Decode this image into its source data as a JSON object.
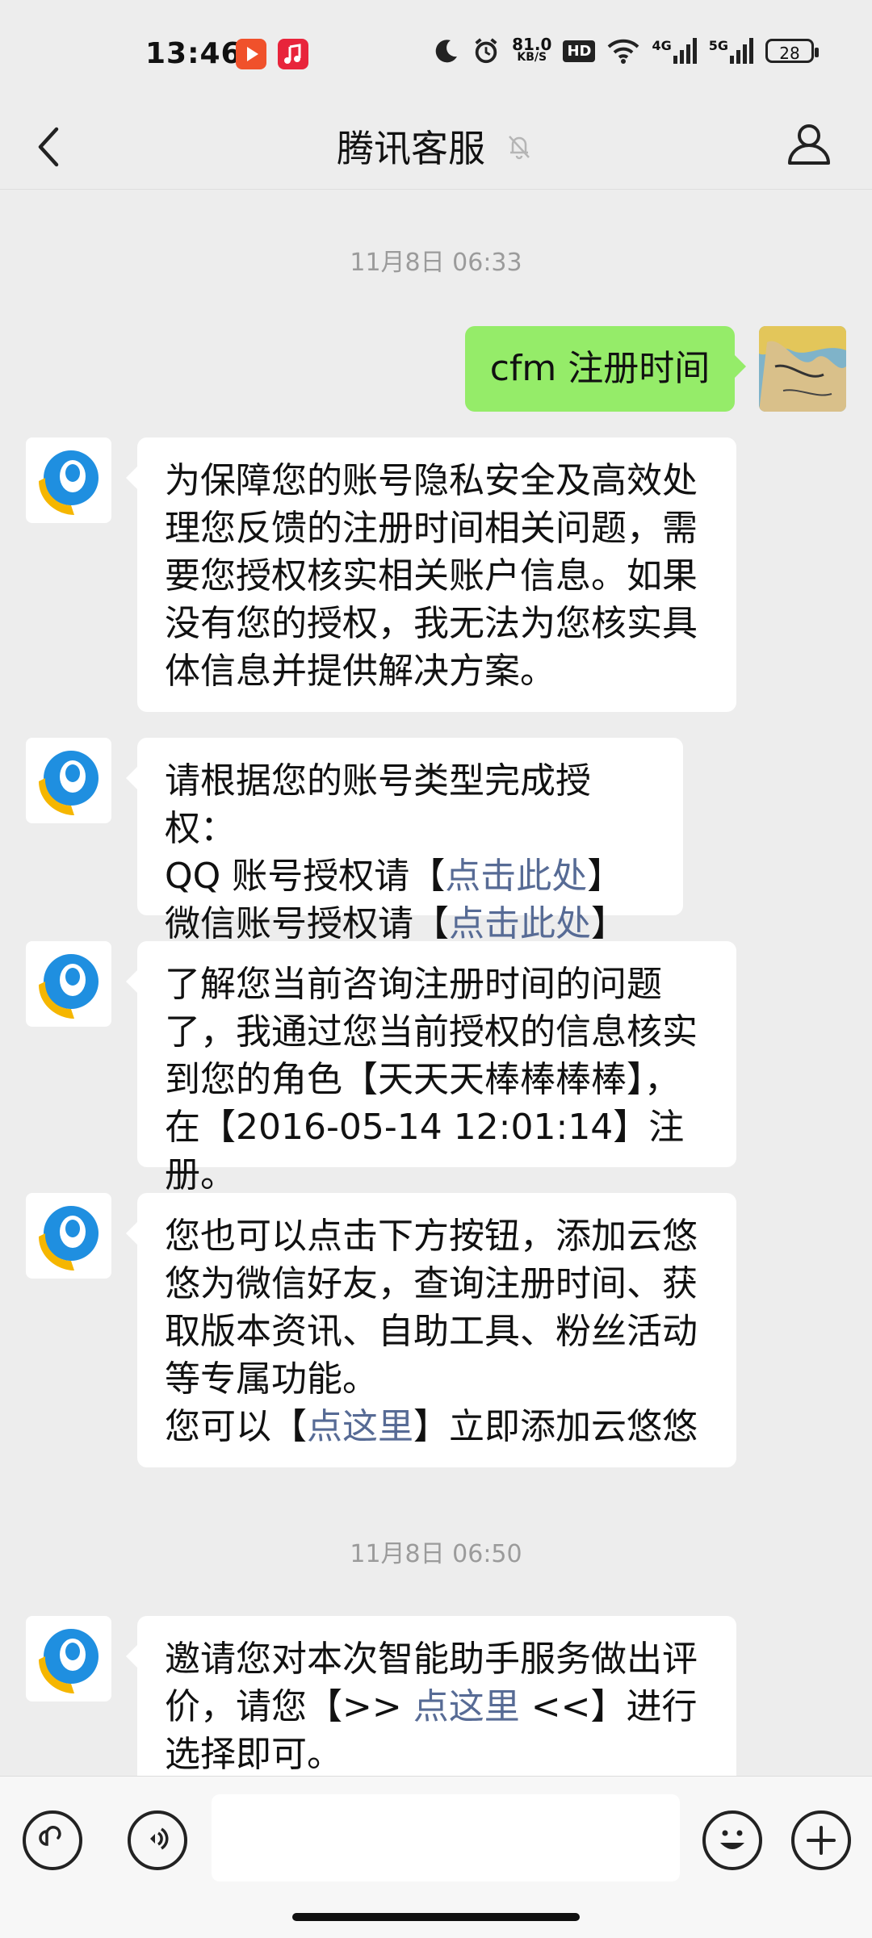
{
  "status_bar": {
    "time": "13:46",
    "net_speed_value": "81.0",
    "net_speed_unit": "KB/S",
    "hd_label": "HD",
    "net_4g": "4G",
    "net_5g": "5G",
    "battery": "28"
  },
  "header": {
    "title": "腾讯客服",
    "icons": [
      "back-icon",
      "mute-bell-icon",
      "profile-icon"
    ]
  },
  "chat": {
    "timestamp_1": "11月8日 06:33",
    "my_message": "cfm 注册时间",
    "msg1": "为保障您的账号隐私安全及高效处理您反馈的注册时间相关问题，需要您授权核实相关账户信息。如果没有您的授权，我无法为您核实具体信息并提供解决方案。",
    "msg2": {
      "line1": "请根据您的账号类型完成授权：",
      "line2_prefix": "QQ 账号授权请【",
      "line2_link": "点击此处",
      "line2_suffix": "】",
      "line3_prefix": "微信账号授权请【",
      "line3_link": "点击此处",
      "line3_suffix": "】"
    },
    "msg3": "了解您当前咨询注册时间的问题了，我通过您当前授权的信息核实到您的角色【天天天棒棒棒棒】，在【2016-05-14 12:01:14】注册。",
    "msg4": {
      "body": "您也可以点击下方按钮，添加云悠悠为微信好友，查询注册时间、获取版本资讯、自助工具、粉丝活动等专属功能。",
      "prefix": "您可以【",
      "link": "点这里",
      "suffix": "】立即添加云悠悠"
    },
    "timestamp_2": "11月8日 06:50",
    "msg5": {
      "prefix": "邀请您对本次智能助手服务做出评价，请您【>> ",
      "link": "点这里",
      "suffix": " <<】进行选择即可。"
    }
  },
  "input_bar": {
    "placeholder": "",
    "icons": [
      "mini-program-icon",
      "voice-icon",
      "emoji-icon",
      "plus-icon"
    ]
  },
  "colors": {
    "background": "#ededed",
    "my_bubble": "#95ec69",
    "link": "#576b95",
    "bot_blue": "#1f8fe0",
    "bot_yellow": "#f5b600"
  }
}
